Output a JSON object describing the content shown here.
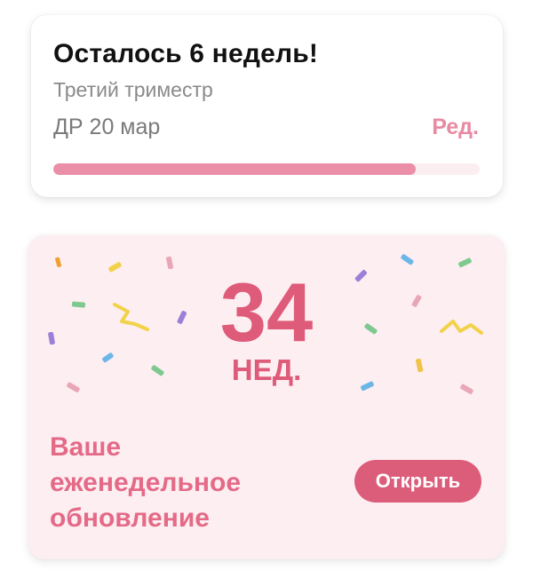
{
  "status_card": {
    "title": "Осталось 6 недель!",
    "subtitle": "Третий триместр",
    "due_date": "ДР 20 мар",
    "edit_label": "Ред.",
    "progress": 0.85
  },
  "weekly_card": {
    "week_number": "34",
    "week_unit": "НЕД.",
    "update_text": "Ваше еженедельное обновление",
    "open_label": "Открыть"
  },
  "colors": {
    "accent": "#de5b7a",
    "accent_light": "#ea8fa7",
    "card_pink_bg": "#fdeef1",
    "confetti": [
      "#f0a030",
      "#f2d24a",
      "#e9a6b8",
      "#7ec98f",
      "#9b7fd8",
      "#6cb6e8"
    ]
  }
}
